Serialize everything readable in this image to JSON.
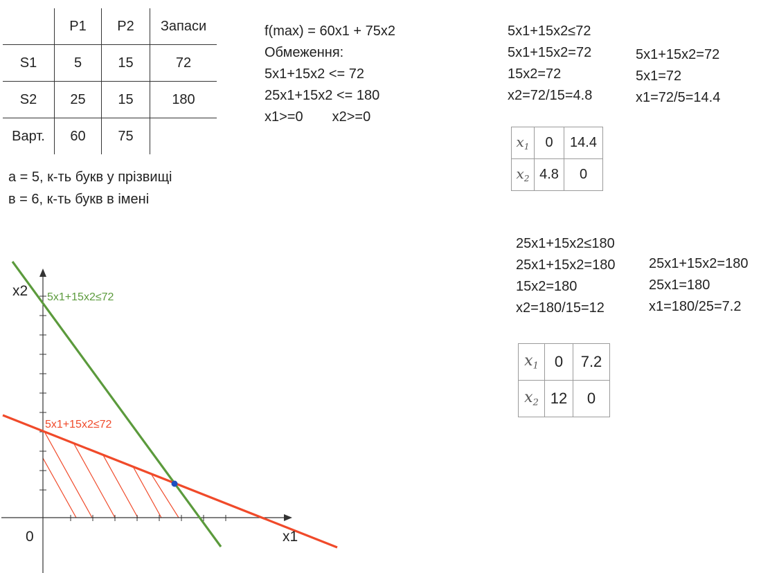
{
  "table": {
    "header": [
      "",
      "P1",
      "P2",
      "Запаси"
    ],
    "rows": [
      [
        "S1",
        "5",
        "15",
        "72"
      ],
      [
        "S2",
        "25",
        "15",
        "180"
      ],
      [
        "Варт.",
        "60",
        "75",
        ""
      ]
    ]
  },
  "params": {
    "a_line": "а = 5, к-ть букв у прізвищі",
    "b_line": "в = 6, к-ть букв в імені"
  },
  "model": {
    "objective": "f(max) = 60x1 + 75x2",
    "constraints_title": "Обмеження:",
    "c1": "5x1+15x2 <= 72",
    "c2": "25x1+15x2 <= 180",
    "nonneg_x1": "x1>=0",
    "nonneg_x2": "x2>=0"
  },
  "calc1": {
    "left": [
      "5x1+15x2≤72",
      "5x1+15x2=72",
      "15x2=72",
      "x2=72/15=4.8"
    ],
    "right": [
      "5x1+15x2=72",
      "5x1=72",
      "x1=72/5=14.4"
    ],
    "table": {
      "x1_label": "x",
      "x1_sub": "1",
      "x1_vals": [
        "0",
        "14.4"
      ],
      "x2_label": "x",
      "x2_sub": "2",
      "x2_vals": [
        "4.8",
        "0"
      ]
    }
  },
  "calc2": {
    "left": [
      "25x1+15x2≤180",
      "25x1+15x2=180",
      "15x2=180",
      "x2=180/15=12"
    ],
    "right": [
      "25x1+15x2=180",
      "25x1=180",
      "x1=180/25=7.2"
    ],
    "table": {
      "x1_label": "x",
      "x1_sub": "1",
      "x1_vals": [
        "0",
        "7.2"
      ],
      "x2_label": "x",
      "x2_sub": "2",
      "x2_vals": [
        "12",
        "0"
      ]
    }
  },
  "graph": {
    "y_axis_label": "x2",
    "x_axis_label": "x1",
    "origin_label": "0",
    "green_line_label": "5x1+15x2≤72",
    "red_line_label": "5x1+15x2≤72",
    "colors": {
      "green": "#5b9a3c",
      "red": "#f04a2a",
      "point": "#1f4fbf",
      "axis": "#333333"
    }
  }
}
